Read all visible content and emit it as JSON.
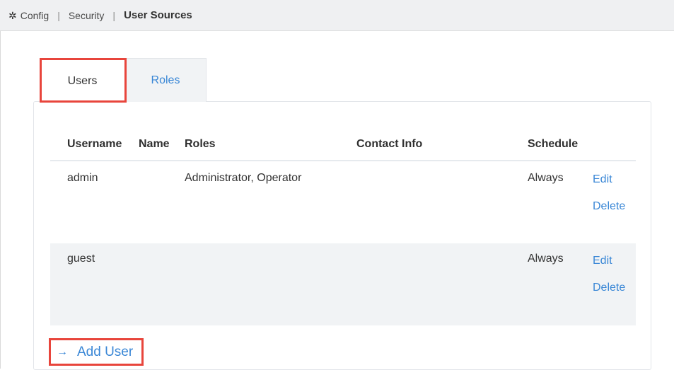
{
  "breadcrumb": {
    "icon": "gear-icon",
    "items": [
      "Config",
      "Security",
      "User Sources"
    ]
  },
  "tabs": [
    {
      "label": "Users",
      "active": true
    },
    {
      "label": "Roles",
      "active": false
    }
  ],
  "table": {
    "columns": [
      "Username",
      "Name",
      "Roles",
      "Contact Info",
      "Schedule"
    ],
    "rows": [
      {
        "username": "admin",
        "name": "",
        "roles": "Administrator, Operator",
        "contact": "",
        "schedule": "Always",
        "edit": "Edit",
        "delete": "Delete"
      },
      {
        "username": "guest",
        "name": "",
        "roles": "",
        "contact": "",
        "schedule": "Always",
        "edit": "Edit",
        "delete": "Delete"
      }
    ]
  },
  "add_user": {
    "icon": "arrow-right-icon",
    "label": "Add User"
  },
  "colors": {
    "link": "#3a87d6",
    "highlight": "#e8453c",
    "active_tab_border": "#2e3a4c"
  }
}
